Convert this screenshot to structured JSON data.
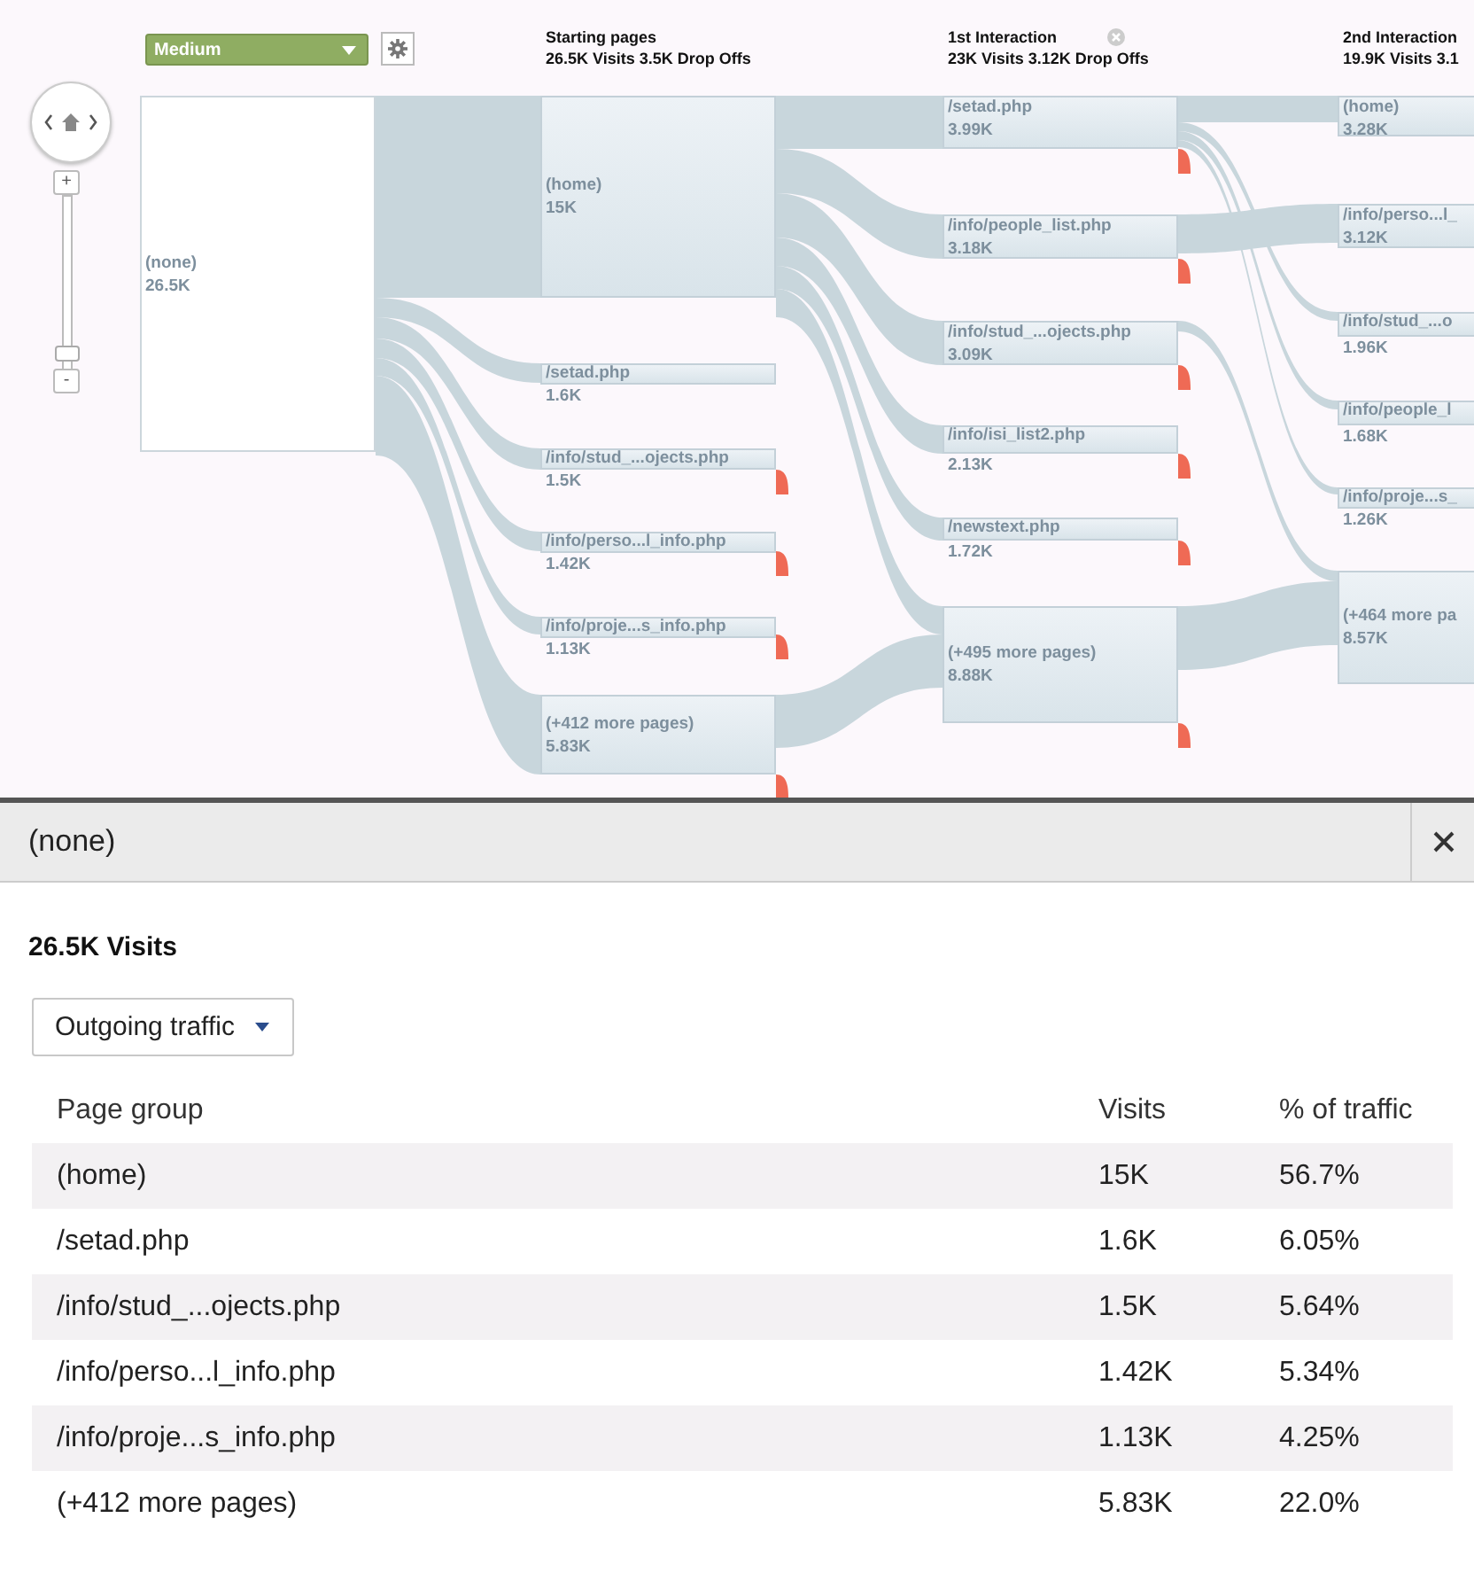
{
  "segment_dropdown": {
    "label": "Medium"
  },
  "zoom": {
    "in_label": "+",
    "out_label": "-",
    "level": 0.12
  },
  "columns": [
    {
      "nodes": [
        {
          "label": "(none)",
          "value": "26.5K",
          "selected": true
        }
      ]
    },
    {
      "title": "Starting pages",
      "summary": "26.5K Visits 3.5K Drop Offs",
      "closable": false,
      "nodes": [
        {
          "label": "(home)",
          "value": "15K",
          "selected": false
        },
        {
          "label": "/setad.php",
          "value": "1.6K",
          "selected": false
        },
        {
          "label": "/info/stud_...ojects.php",
          "value": "1.5K",
          "selected": false,
          "drop_off": true
        },
        {
          "label": "/info/perso...l_info.php",
          "value": "1.42K",
          "selected": false,
          "drop_off": true
        },
        {
          "label": "/info/proje...s_info.php",
          "value": "1.13K",
          "selected": false,
          "drop_off": true
        },
        {
          "label": "(+412 more pages)",
          "value": "5.83K",
          "selected": false,
          "drop_off": true
        }
      ]
    },
    {
      "title": "1st Interaction",
      "summary": "23K Visits 3.12K Drop Offs",
      "closable": true,
      "nodes": [
        {
          "label": "/setad.php",
          "value": "3.99K",
          "selected": false,
          "drop_off": true
        },
        {
          "label": "/info/people_list.php",
          "value": "3.18K",
          "selected": false,
          "drop_off": true
        },
        {
          "label": "/info/stud_...ojects.php",
          "value": "3.09K",
          "selected": false,
          "drop_off": true
        },
        {
          "label": "/info/isi_list2.php",
          "value": "2.13K",
          "selected": false,
          "drop_off": true
        },
        {
          "label": "/newstext.php",
          "value": "1.72K",
          "selected": false,
          "drop_off": true
        },
        {
          "label": "(+495 more pages)",
          "value": "8.88K",
          "selected": false,
          "drop_off": true
        }
      ]
    },
    {
      "title": "2nd Interaction",
      "summary": "19.9K Visits 3.1",
      "closable": false,
      "nodes": [
        {
          "label": "(home)",
          "value": "3.28K",
          "selected": false
        },
        {
          "label": "/info/perso...l_",
          "value": "3.12K",
          "selected": false
        },
        {
          "label": "/info/stud_...o",
          "value": "1.96K",
          "selected": false
        },
        {
          "label": "/info/people_l",
          "value": "1.68K",
          "selected": false
        },
        {
          "label": "/info/proje...s_",
          "value": "1.26K",
          "selected": false
        },
        {
          "label": "(+464 more pa",
          "value": "8.57K",
          "selected": false
        }
      ]
    }
  ],
  "detail_panel": {
    "title": "(none)",
    "summary": "26.5K Visits",
    "traffic_dropdown": {
      "label": "Outgoing traffic"
    },
    "table": {
      "columns": [
        "Page group",
        "Visits",
        "% of traffic"
      ],
      "rows": [
        {
          "cells": [
            "(home)",
            "15K",
            "56.7%"
          ]
        },
        {
          "cells": [
            "/setad.php",
            "1.6K",
            "6.05%"
          ]
        },
        {
          "cells": [
            "/info/stud_...ojects.php",
            "1.5K",
            "5.64%"
          ]
        },
        {
          "cells": [
            "/info/perso...l_info.php",
            "1.42K",
            "5.34%"
          ]
        },
        {
          "cells": [
            "/info/proje...s_info.php",
            "1.13K",
            "4.25%"
          ]
        },
        {
          "cells": [
            "(+412 more pages)",
            "5.83K",
            "22.0%"
          ]
        }
      ]
    }
  }
}
